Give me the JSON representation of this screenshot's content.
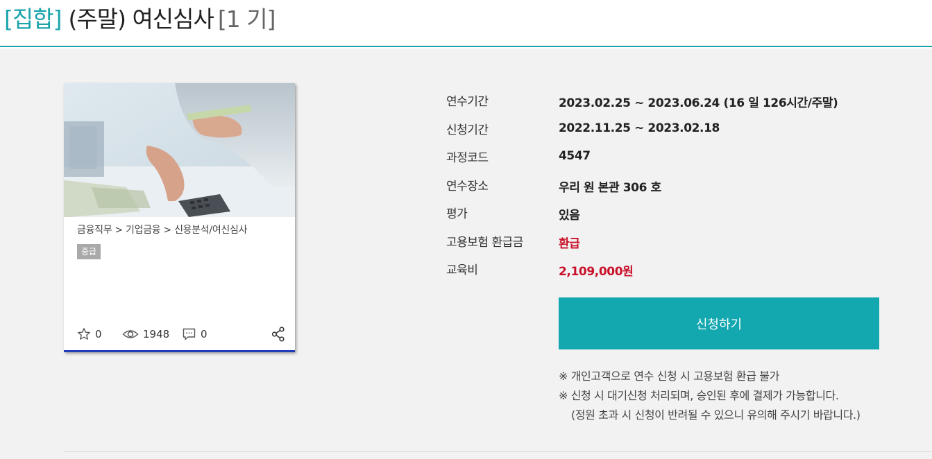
{
  "header": {
    "type": "[집합]",
    "name": "(주말) 여신심사",
    "generation": "[1 기]"
  },
  "card": {
    "image_alt": "hand-calculator-photo",
    "category_path": "금융직무 > 기업금융 > 신용분석/여신심사",
    "level": "중급",
    "likes": "0",
    "views": "1948",
    "comments": "0"
  },
  "info": [
    {
      "label": "연수기간",
      "value": "2023.02.25 ~ 2023.06.24 (16 일 126시간/주말)",
      "highlight": false
    },
    {
      "label": "신청기간",
      "value": "2022.11.25 ~ 2023.02.18",
      "highlight": false
    },
    {
      "label": "과정코드",
      "value": "4547",
      "highlight": false
    },
    {
      "label": "연수장소",
      "value": "우리 원 본관 306 호",
      "highlight": false
    },
    {
      "label": "평가",
      "value": "있음",
      "highlight": false
    },
    {
      "label": "고용보험 환급금",
      "value": "환급",
      "highlight": true
    },
    {
      "label": "교육비",
      "value": "2,109,000원",
      "highlight": true
    }
  ],
  "apply_button": "신청하기",
  "notes": [
    "※ 개인고객으로 연수 신청 시 고용보험 환급 불가",
    "※ 신청 시 대기신청 처리되며, 승인된 후에 결제가 가능합니다.",
    "(정원 초과 시 신청이 반려될 수 있으니 유의해 주시기 바랍니다.)"
  ],
  "colors": {
    "accent": "#13a7af",
    "highlight": "#c9112a",
    "card_border": "#1f3bb5"
  },
  "icons": [
    "star-icon",
    "eye-icon",
    "comment-icon",
    "share-icon"
  ]
}
